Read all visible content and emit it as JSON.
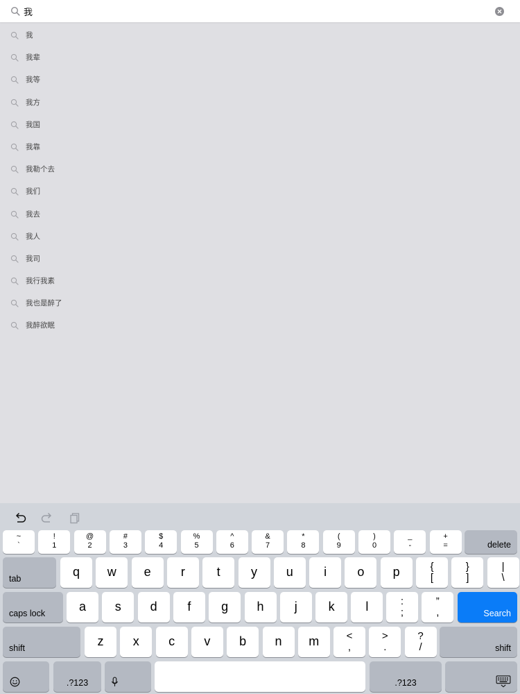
{
  "search": {
    "value": "我"
  },
  "suggestions": [
    "我",
    "我辈",
    "我等",
    "我方",
    "我国",
    "我靠",
    "我勒个去",
    "我们",
    "我去",
    "我人",
    "我司",
    "我行我素",
    "我也是醉了",
    "我醉欲眠"
  ],
  "toolbar": {
    "undo": "undo-icon",
    "redo": "redo-icon",
    "paste": "paste-icon"
  },
  "keyboard": {
    "number_row": [
      {
        "top": "~",
        "bottom": "`"
      },
      {
        "top": "!",
        "bottom": "1"
      },
      {
        "top": "@",
        "bottom": "2"
      },
      {
        "top": "#",
        "bottom": "3"
      },
      {
        "top": "$",
        "bottom": "4"
      },
      {
        "top": "%",
        "bottom": "5"
      },
      {
        "top": "^",
        "bottom": "6"
      },
      {
        "top": "&",
        "bottom": "7"
      },
      {
        "top": "*",
        "bottom": "8"
      },
      {
        "top": "(",
        "bottom": "9"
      },
      {
        "top": ")",
        "bottom": "0"
      },
      {
        "top": "_",
        "bottom": "-"
      },
      {
        "top": "+",
        "bottom": "="
      }
    ],
    "delete": "delete",
    "tab": "tab",
    "row_q": [
      "q",
      "w",
      "e",
      "r",
      "t",
      "y",
      "u",
      "i",
      "o",
      "p"
    ],
    "row_q_punct": [
      {
        "top": "{",
        "bottom": "["
      },
      {
        "top": "}",
        "bottom": "]"
      },
      {
        "top": "|",
        "bottom": "\\"
      }
    ],
    "caps_lock": "caps lock",
    "row_a": [
      "a",
      "s",
      "d",
      "f",
      "g",
      "h",
      "j",
      "k",
      "l"
    ],
    "row_a_punct": [
      {
        "top": ":",
        "bottom": ";"
      },
      {
        "top": "”",
        "bottom": ","
      }
    ],
    "search": "Search",
    "shift": "shift",
    "row_z": [
      "z",
      "x",
      "c",
      "v",
      "b",
      "n",
      "m"
    ],
    "row_z_punct": [
      {
        "top": "<",
        "bottom": ","
      },
      {
        "top": ">",
        "bottom": "."
      },
      {
        "top": "?",
        "bottom": "/"
      }
    ],
    "numbers": ".?123",
    "icons": {
      "emoji": "emoji-icon",
      "mic": "microphone-icon",
      "hide": "keyboard-hide-icon"
    },
    "colors": {
      "search_key": "#0a7cf8",
      "background": "#d1d5db",
      "function_key": "#b4b9c2"
    }
  }
}
